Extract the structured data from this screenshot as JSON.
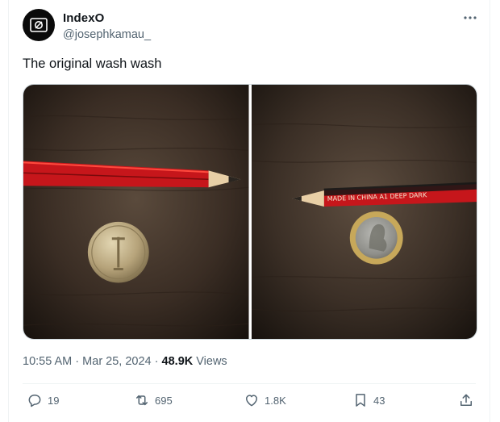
{
  "author": {
    "name": "IndexO",
    "handle": "@josephkamau_"
  },
  "tweet": {
    "text": "The original wash wash"
  },
  "photos": [
    {
      "alt": "Red pencil next to a coin with a standing figure on a wooden surface"
    },
    {
      "alt": "Red pencil reading MADE IN CHINA A1 DEEP DARK next to a coin with a portrait",
      "pencil_text": "MADE IN CHINA      A1  DEEP DARK"
    }
  ],
  "meta": {
    "time": "10:55 AM",
    "sep1": "·",
    "date": "Mar 25, 2024",
    "sep2": "·",
    "views_count": "48.9K",
    "views_label": "Views"
  },
  "actions": {
    "replies": "19",
    "reposts": "695",
    "likes": "1.8K",
    "bookmarks": "43"
  },
  "icons": [
    "more-icon",
    "reply-icon",
    "repost-icon",
    "like-icon",
    "bookmark-icon",
    "share-icon"
  ]
}
